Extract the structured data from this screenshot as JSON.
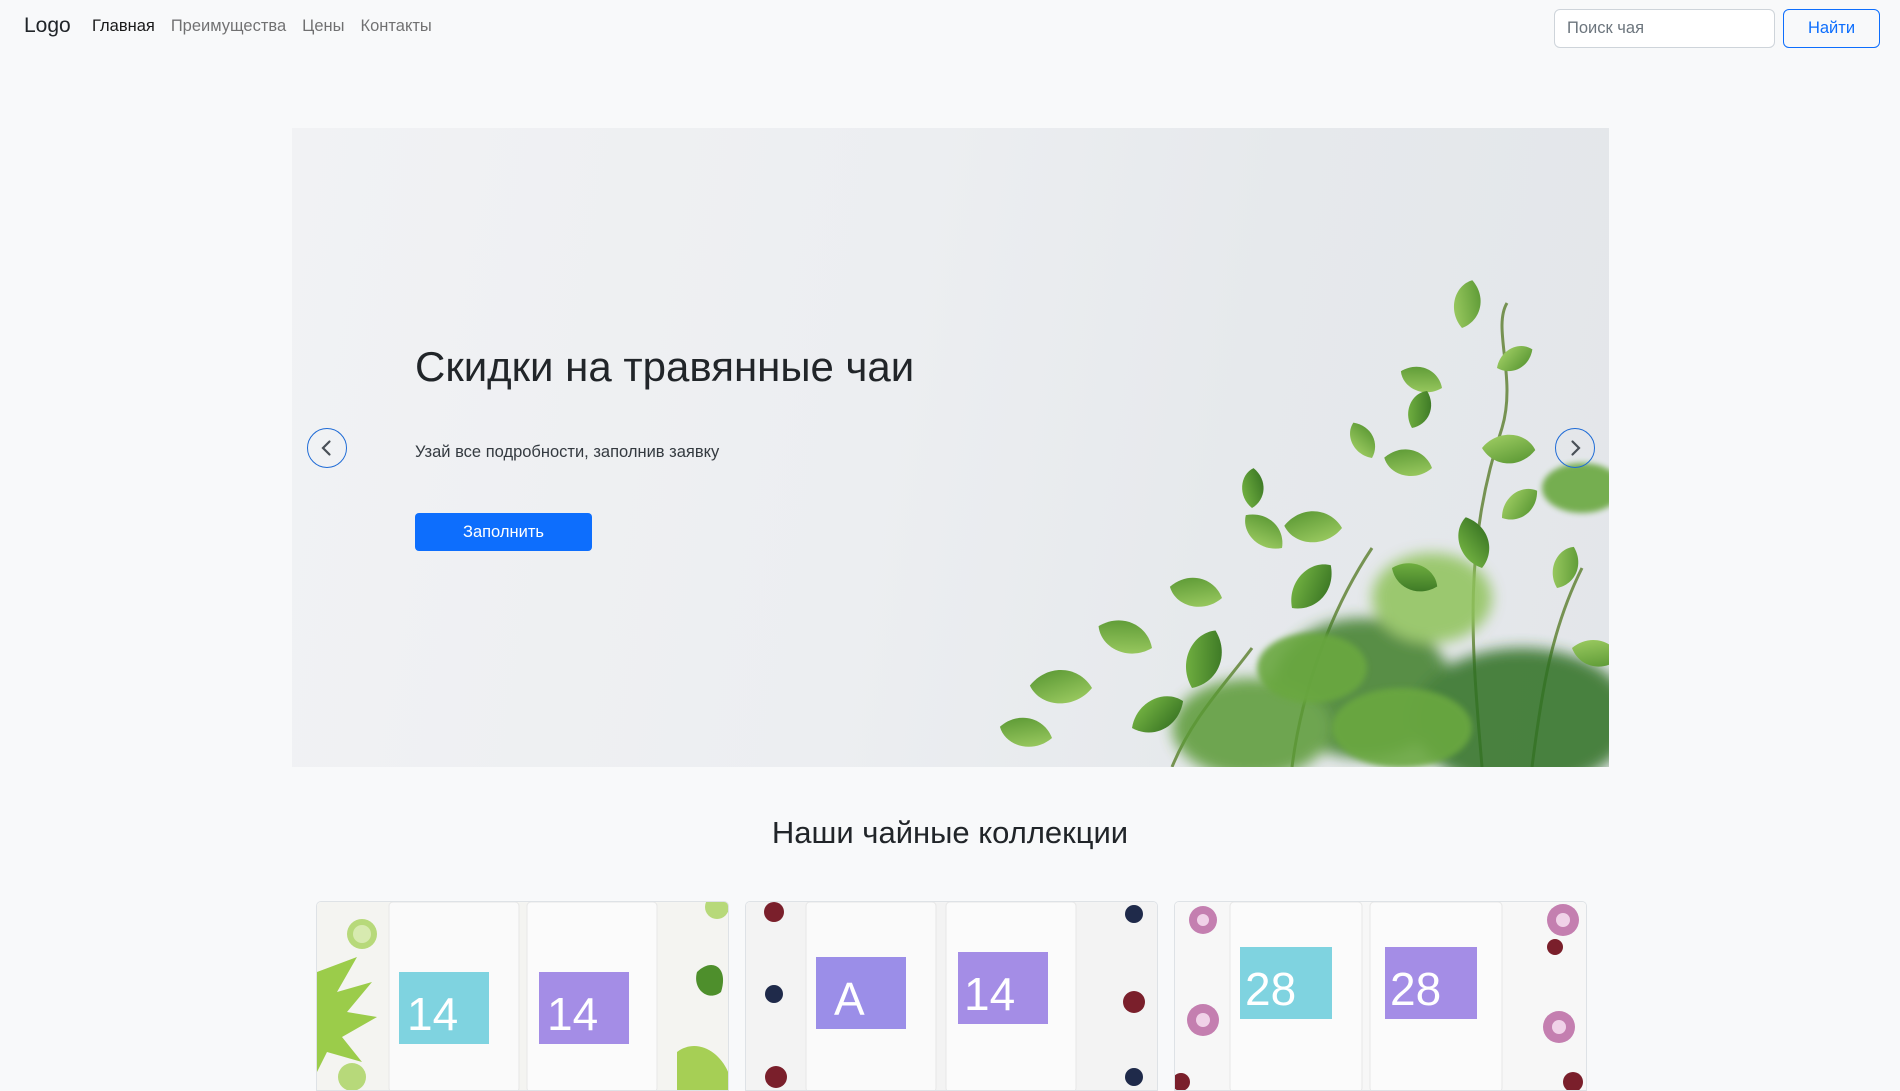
{
  "navbar": {
    "brand": "Logo",
    "links": [
      {
        "label": "Главная",
        "active": true
      },
      {
        "label": "Преимущества",
        "active": false
      },
      {
        "label": "Цены",
        "active": false
      },
      {
        "label": "Контакты",
        "active": false
      }
    ],
    "search": {
      "placeholder": "Поиск чая",
      "value": ""
    },
    "search_button": "Найти"
  },
  "hero": {
    "title": "Скидки на травянные чаи",
    "subtitle": "Узай все подробности, заполнив заявку",
    "button": "Заполнить",
    "prev_icon": "chevron-left-icon",
    "next_icon": "chevron-right-icon"
  },
  "collections": {
    "title": "Наши чайные коллекции",
    "cards": [
      {
        "labels": [
          "14",
          "14"
        ],
        "label_colors": [
          "#7fd3e0",
          "#a48de6"
        ]
      },
      {
        "labels": [
          "A",
          "14"
        ],
        "label_colors": [
          "#9b8ee8",
          "#a48de6"
        ]
      },
      {
        "labels": [
          "28",
          "28"
        ],
        "label_colors": [
          "#7fd3e0",
          "#a48de6"
        ]
      }
    ]
  },
  "colors": {
    "primary": "#0d6efd",
    "background": "#f8f9fa",
    "leaf": "#6aa840"
  }
}
